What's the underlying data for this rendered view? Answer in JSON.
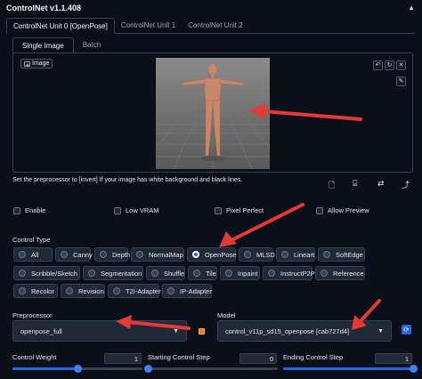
{
  "header": {
    "title": "ControlNet v1.1.408",
    "collapse_icon": "triangle-up"
  },
  "unit_tabs": [
    "ControlNet Unit 0 [OpenPose]",
    "ControlNet Unit 1",
    "ControlNet Unit 2"
  ],
  "image_tabs": [
    "Single Image",
    "Batch"
  ],
  "image_panel": {
    "label": "Image"
  },
  "note": "Set the preprocessor to [invert] If your image has white background and black lines.",
  "checkboxes": [
    "Enable",
    "Low VRAM",
    "Pixel Perfect",
    "Allow Preview"
  ],
  "control_type": {
    "label": "Control Type",
    "options": [
      "All",
      "Canny",
      "Depth",
      "NormalMap",
      "OpenPose",
      "MLSD",
      "Lineart",
      "SoftEdge",
      "Scribble/Sketch",
      "Segmentation",
      "Shuffle",
      "Tile",
      "Inpaint",
      "InstructP2P",
      "Reference",
      "Recolor",
      "Revision",
      "T2I-Adapter",
      "IP-Adapter"
    ],
    "selected": "OpenPose"
  },
  "preprocessor": {
    "label": "Preprocessor",
    "value": "openpose_full"
  },
  "model": {
    "label": "Model",
    "value": "control_v11p_sd15_openpose [cab727d4]"
  },
  "sliders": [
    {
      "label": "Control Weight",
      "value": "1",
      "fraction": 0.5
    },
    {
      "label": "Starting Control Step",
      "value": "0",
      "fraction": 0.0
    },
    {
      "label": "Ending Control Step",
      "value": "1",
      "fraction": 1.0
    }
  ],
  "colors": {
    "accent": "#2563eb",
    "arrow": "#e53935",
    "background": "#0b0f19",
    "orange_icon": "#f97316"
  }
}
